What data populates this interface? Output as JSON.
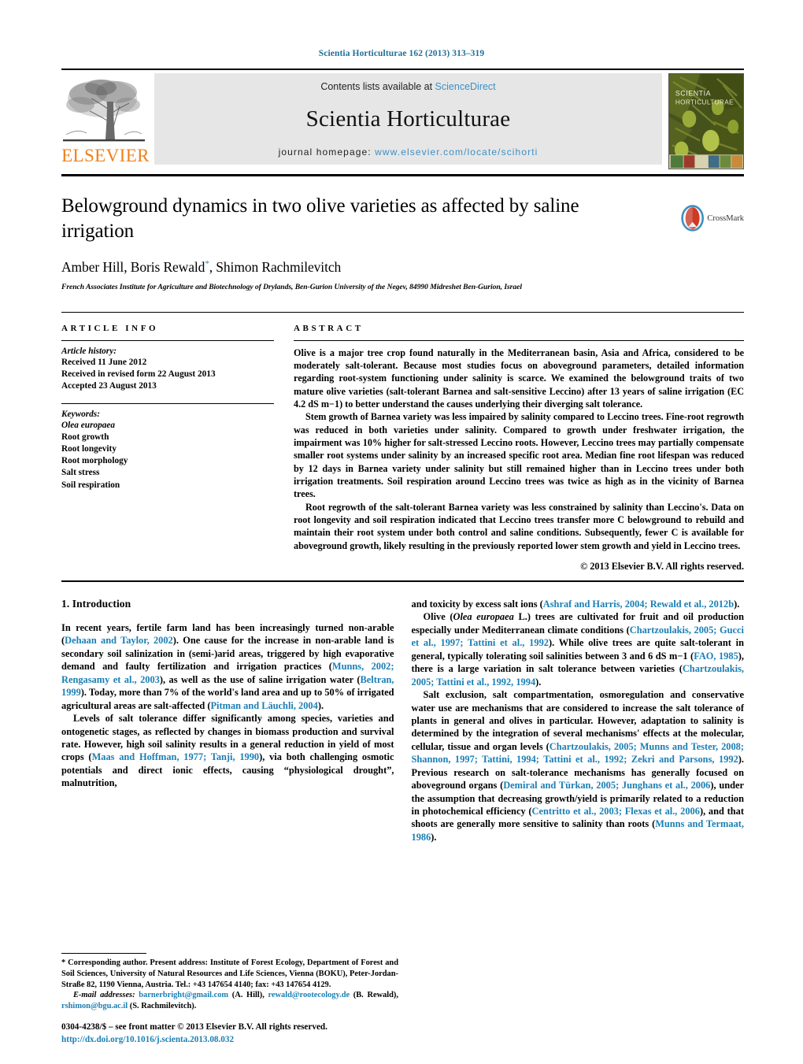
{
  "running_head": "Scientia Horticulturae 162 (2013) 313–319",
  "masthead": {
    "publisher_name": "ELSEVIER",
    "contents_prefix": "Contents lists available at ",
    "contents_link": "ScienceDirect",
    "journal_name": "Scientia Horticulturae",
    "homepage_prefix": "journal homepage: ",
    "homepage_url": "www.elsevier.com/locate/scihorti",
    "cover_title_line1": "SCIENTIA",
    "cover_title_line2": "HORTICULTURAE"
  },
  "article": {
    "title": "Belowground dynamics in two olive varieties as affected by saline irrigation",
    "authors": "Amber Hill, Boris Rewald",
    "authors_tail": ", Shimon Rachmilevitch",
    "corresponding_marker": "*",
    "affiliation": "French Associates Institute for Agriculture and Biotechnology of Drylands, Ben-Gurion University of the Negev, 84990 Midreshet Ben-Gurion, Israel",
    "crossmark_label": "CrossMark"
  },
  "article_info": {
    "heading": "ARTICLE INFO",
    "history_label": "Article history:",
    "history": [
      "Received 11 June 2012",
      "Received in revised form 22 August 2013",
      "Accepted 23 August 2013"
    ],
    "keywords_label": "Keywords:",
    "keywords": [
      "Olea europaea",
      "Root growth",
      "Root longevity",
      "Root morphology",
      "Salt stress",
      "Soil respiration"
    ]
  },
  "abstract": {
    "heading": "ABSTRACT",
    "paragraphs": [
      "Olive is a major tree crop found naturally in the Mediterranean basin, Asia and Africa, considered to be moderately salt-tolerant. Because most studies focus on aboveground parameters, detailed information regarding root-system functioning under salinity is scarce. We examined the belowground traits of two mature olive varieties (salt-tolerant Barnea and salt-sensitive Leccino) after 13 years of saline irrigation (EC 4.2 dS m−1) to better understand the causes underlying their diverging salt tolerance.",
      "Stem growth of Barnea variety was less impaired by salinity compared to Leccino trees. Fine-root regrowth was reduced in both varieties under salinity. Compared to growth under freshwater irrigation, the impairment was 10% higher for salt-stressed Leccino roots. However, Leccino trees may partially compensate smaller root systems under salinity by an increased specific root area. Median fine root lifespan was reduced by 12 days in Barnea variety under salinity but still remained higher than in Leccino trees under both irrigation treatments. Soil respiration around Leccino trees was twice as high as in the vicinity of Barnea trees.",
      "Root regrowth of the salt-tolerant Barnea variety was less constrained by salinity than Leccino's. Data on root longevity and soil respiration indicated that Leccino trees transfer more C belowground to rebuild and maintain their root system under both control and saline conditions. Subsequently, fewer C is available for aboveground growth, likely resulting in the previously reported lower stem growth and yield in Leccino trees."
    ],
    "copyright": "© 2013 Elsevier B.V. All rights reserved."
  },
  "introduction": {
    "heading": "1.  Introduction",
    "left_paragraphs": [
      [
        {
          "t": "In recent years, fertile farm land has been increasingly turned non-arable ("
        },
        {
          "t": "Dehaan and Taylor, 2002",
          "r": true
        },
        {
          "t": "). One cause for the increase in non-arable land is secondary soil salinization in (semi-)arid areas, triggered by high evaporative demand and faulty fertilization and irrigation practices ("
        },
        {
          "t": "Munns, 2002; Rengasamy et al., 2003",
          "r": true
        },
        {
          "t": "), as well as the use of saline irrigation water ("
        },
        {
          "t": "Beltran, 1999",
          "r": true
        },
        {
          "t": "). Today, more than 7% of the world's land area and up to 50% of irrigated agricultural areas are salt-affected ("
        },
        {
          "t": "Pitman and Läuchli, 2004",
          "r": true
        },
        {
          "t": ")."
        }
      ],
      [
        {
          "t": "Levels of salt tolerance differ significantly among species, varieties and ontogenetic stages, as reflected by changes in biomass production and survival rate. However, high soil salinity results in a general reduction in yield of most crops ("
        },
        {
          "t": "Maas and Hoffman, 1977; Tanji, 1990",
          "r": true
        },
        {
          "t": "), via both challenging osmotic potentials and direct ionic effects, causing “physiological drought”, malnutrition,"
        }
      ]
    ],
    "right_paragraphs": [
      [
        {
          "t": "and toxicity by excess salt ions ("
        },
        {
          "t": "Ashraf and Harris, 2004; Rewald et al., 2012b",
          "r": true
        },
        {
          "t": ")."
        }
      ],
      [
        {
          "t": "Olive ("
        },
        {
          "t": "Olea europaea",
          "i": true
        },
        {
          "t": " L.) trees are cultivated for fruit and oil production especially under Mediterranean climate conditions ("
        },
        {
          "t": "Chartzoulakis, 2005; Gucci et al., 1997; Tattini et al., 1992",
          "r": true
        },
        {
          "t": "). While olive trees are quite salt-tolerant in general, typically tolerating soil salinities between 3 and 6 dS m−1 ("
        },
        {
          "t": "FAO, 1985",
          "r": true
        },
        {
          "t": "), there is a large variation in salt tolerance between varieties ("
        },
        {
          "t": "Chartzoulakis, 2005; Tattini et al., 1992, 1994",
          "r": true
        },
        {
          "t": ")."
        }
      ],
      [
        {
          "t": "Salt exclusion, salt compartmentation, osmoregulation and conservative water use are mechanisms that are considered to increase the salt tolerance of plants in general and olives in particular. However, adaptation to salinity is determined by the integration of several mechanisms' effects at the molecular, cellular, tissue and organ levels ("
        },
        {
          "t": "Chartzoulakis, 2005; Munns and Tester, 2008; Shannon, 1997; Tattini, 1994; Tattini et al., 1992; Zekri and Parsons, 1992",
          "r": true
        },
        {
          "t": "). Previous research on salt-tolerance mechanisms has generally focused on aboveground organs ("
        },
        {
          "t": "Demiral and Türkan, 2005; Junghans et al., 2006",
          "r": true
        },
        {
          "t": "), under the assumption that decreasing growth/yield is primarily related to a reduction in photochemical efficiency ("
        },
        {
          "t": "Centritto et al., 2003; Flexas et al., 2006",
          "r": true
        },
        {
          "t": "), and that shoots are generally more sensitive to salinity than roots ("
        },
        {
          "t": "Munns and Termaat, 1986",
          "r": true
        },
        {
          "t": ")."
        }
      ]
    ]
  },
  "footnote": {
    "corresponding": "* Corresponding author. Present address: Institute of Forest Ecology, Department of Forest and Soil Sciences, University of Natural Resources and Life Sciences, Vienna (BOKU), Peter-Jordan-Straße 82, 1190 Vienna, Austria. Tel.: +43 147654 4140; fax: +43 147654 4129.",
    "email_label": "E-mail addresses:",
    "emails": [
      {
        "address": "barnerbright@gmail.com",
        "who": " (A. Hill), "
      },
      {
        "address": "rewald@rootecology.de",
        "who": " (B. Rewald), "
      },
      {
        "address": "rshimon@bgu.ac.il",
        "who": " (S. Rachmilevitch)."
      }
    ]
  },
  "imprint": {
    "line1": "0304-4238/$ – see front matter © 2013 Elsevier B.V. All rights reserved.",
    "doi": "http://dx.doi.org/10.1016/j.scienta.2013.08.032"
  },
  "colors": {
    "link": "#1a7fb5",
    "sciencedirect": "#3d8fc4",
    "elsevier_orange": "#f07f1a",
    "runhead": "#1f6f9a"
  }
}
